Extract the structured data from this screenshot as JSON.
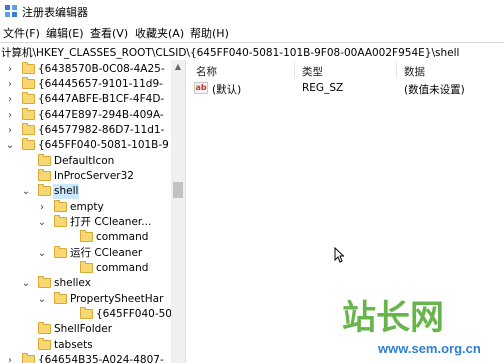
{
  "window": {
    "title": "注册表编辑器",
    "icon": "regedit-icon"
  },
  "menu": [
    {
      "label": "文件(F)"
    },
    {
      "label": "编辑(E)"
    },
    {
      "label": "查看(V)"
    },
    {
      "label": "收藏夹(A)"
    },
    {
      "label": "帮助(H)"
    }
  ],
  "address": {
    "path": "计算机\\HKEY_CLASSES_ROOT\\CLSID\\{645FF040-5081-101B-9F08-00AA002F954E}\\shell"
  },
  "tree": {
    "items": [
      {
        "label": "{6438570B-0C08-4A25-",
        "expanded": false,
        "has_children": true
      },
      {
        "label": "{64445657-9101-11d9-",
        "expanded": false,
        "has_children": true
      },
      {
        "label": "{6447ABFE-B1CF-4F4D-",
        "expanded": false,
        "has_children": true
      },
      {
        "label": "{6447E897-294B-409A-",
        "expanded": false,
        "has_children": true
      },
      {
        "label": "{64577982-86D7-11d1-",
        "expanded": false,
        "has_children": true
      },
      {
        "label": "{645FF040-5081-101B-9",
        "expanded": true,
        "has_children": true
      },
      {
        "label": "DefaultIcon",
        "expanded": false,
        "has_children": false
      },
      {
        "label": "InProcServer32",
        "expanded": false,
        "has_children": false
      },
      {
        "label": "shell",
        "expanded": true,
        "has_children": true,
        "selected": true
      },
      {
        "label": "empty",
        "expanded": false,
        "has_children": true
      },
      {
        "label": "打开 CCleaner...",
        "expanded": true,
        "has_children": true
      },
      {
        "label": "command",
        "expanded": false,
        "has_children": false
      },
      {
        "label": "运行 CCleaner",
        "expanded": true,
        "has_children": true
      },
      {
        "label": "command",
        "expanded": false,
        "has_children": false
      },
      {
        "label": "shellex",
        "expanded": true,
        "has_children": true
      },
      {
        "label": "PropertySheetHar",
        "expanded": true,
        "has_children": true
      },
      {
        "label": "{645FF040-508",
        "expanded": false,
        "has_children": false
      },
      {
        "label": "ShellFolder",
        "expanded": false,
        "has_children": false
      },
      {
        "label": "tabsets",
        "expanded": false,
        "has_children": false
      },
      {
        "label": "{64654B35-A024-4807-",
        "expanded": false,
        "has_children": true
      }
    ]
  },
  "list": {
    "columns": [
      {
        "label": "名称"
      },
      {
        "label": "类型"
      },
      {
        "label": "数据"
      }
    ],
    "rows": [
      {
        "name": "(默认)",
        "type": "REG_SZ",
        "data": "(数值未设置)",
        "icon": "string-value-icon"
      }
    ]
  },
  "watermark": {
    "logo_text": "站长网",
    "url": "www.sem.org.cn"
  },
  "colors": {
    "selection": "#cce8ff",
    "folder": "#f7d774",
    "watermark_green": "#4ea82e",
    "watermark_blue": "#2e7fd1"
  }
}
